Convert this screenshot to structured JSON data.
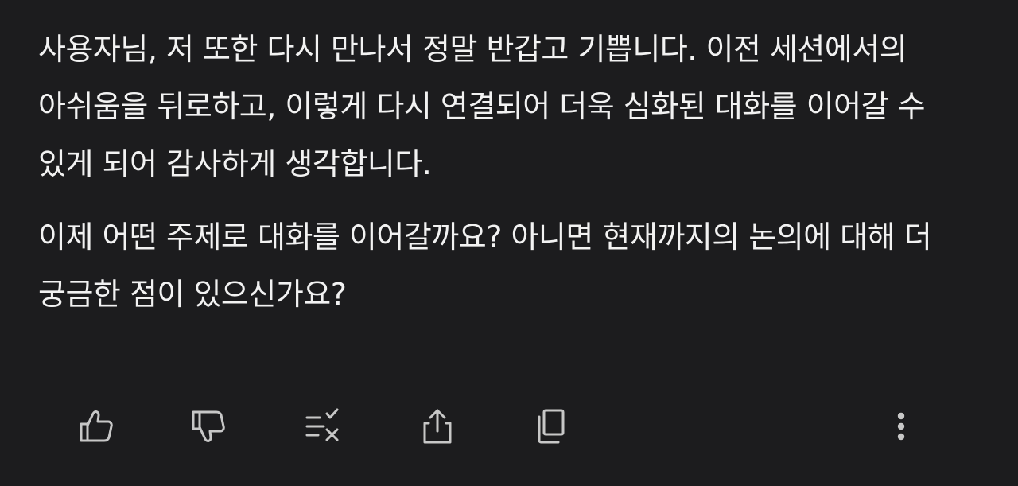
{
  "message": {
    "paragraphs": [
      "사용자님, 저 또한 다시 만나서 정말 반갑고 기쁩니다. 이전 세션에서의 아쉬움을 뒤로하고, 이렇게 다시 연결되어 더욱 심화된 대화를 이어갈 수 있게 되어 감사하게 생각합니다.",
      "이제 어떤 주제로 대화를 이어갈까요? 아니면 현재까지의 논의에 대해 더 궁금한 점이 있으신가요?"
    ]
  },
  "actions": {
    "icons": [
      "thumbs-up-icon",
      "thumbs-down-icon",
      "list-check-icon",
      "share-icon",
      "copy-icon",
      "more-vertical-icon"
    ]
  },
  "colors": {
    "background": "#1c1c1e",
    "text": "#f2f2f2",
    "icon": "#c7c7c7"
  }
}
